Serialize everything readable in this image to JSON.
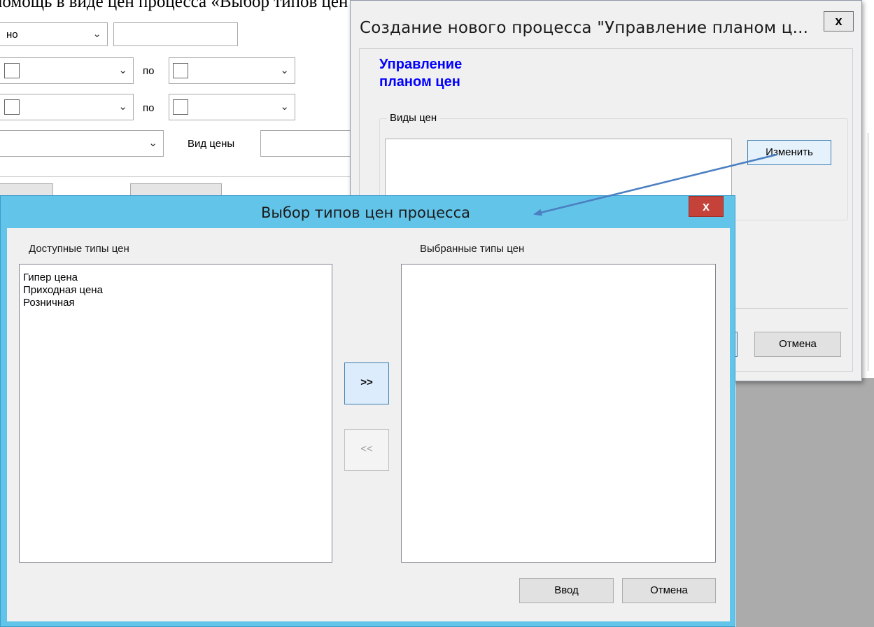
{
  "document_header": {
    "text": "помощь в виде цен процесса «Выбор типов цен процесса» (Рисунок )."
  },
  "background_form": {
    "combo1_text": "но",
    "po_label": "по",
    "price_kind_label": "Вид цены"
  },
  "create_dialog": {
    "title": "Создание нового процесса \"Управление планом ц...",
    "close_label": "x",
    "heading_line1": "Управление",
    "heading_line2": "планом цен",
    "group_label": "Виды цен",
    "change_button": "Изменить",
    "cancel_button": "Отмена"
  },
  "select_dialog": {
    "title": "Выбор типов цен процесса",
    "close_label": "x",
    "available_label": "Доступные типы цен",
    "selected_label": "Выбранные типы цен",
    "available_items": [
      "Гипер цена",
      "Приходная цена",
      "Розничная"
    ],
    "selected_items": [],
    "add_button": ">>",
    "remove_button": "<<",
    "ok_button": "Ввод",
    "cancel_button": "Отмена"
  },
  "colors": {
    "dialog_frame": "#63c4ea",
    "close_red": "#c5423a",
    "heading_blue": "#0000ff",
    "arrow_blue": "#4a7fc1"
  }
}
